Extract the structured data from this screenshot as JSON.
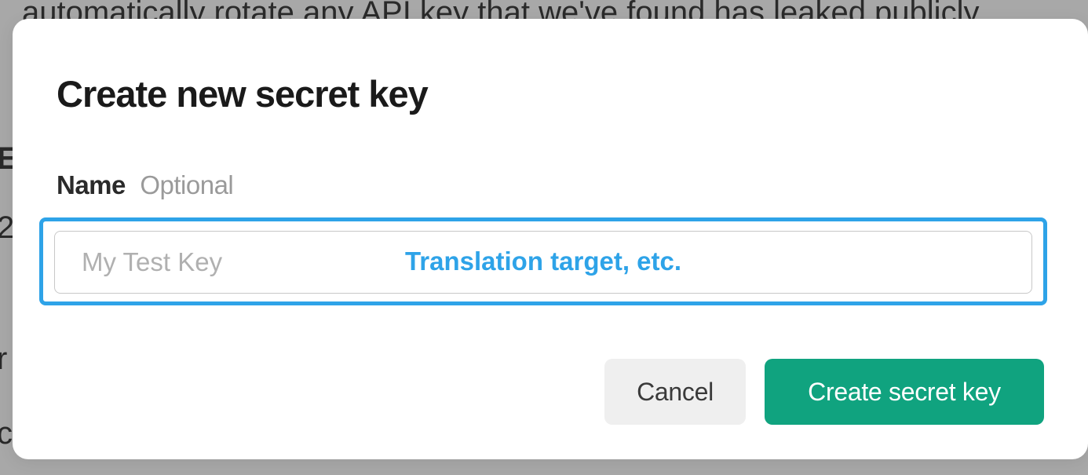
{
  "background": {
    "line1": "automatically rotate any API key that we've found has leaked publicly",
    "glyph1": "E",
    "glyph2": "2",
    "glyph3": "r",
    "glyph4": "c"
  },
  "modal": {
    "title": "Create new secret key",
    "field": {
      "label": "Name",
      "optional_text": "Optional",
      "placeholder": "My Test Key",
      "overlay_hint": "Translation target, etc."
    },
    "buttons": {
      "cancel": "Cancel",
      "create": "Create secret key"
    }
  }
}
